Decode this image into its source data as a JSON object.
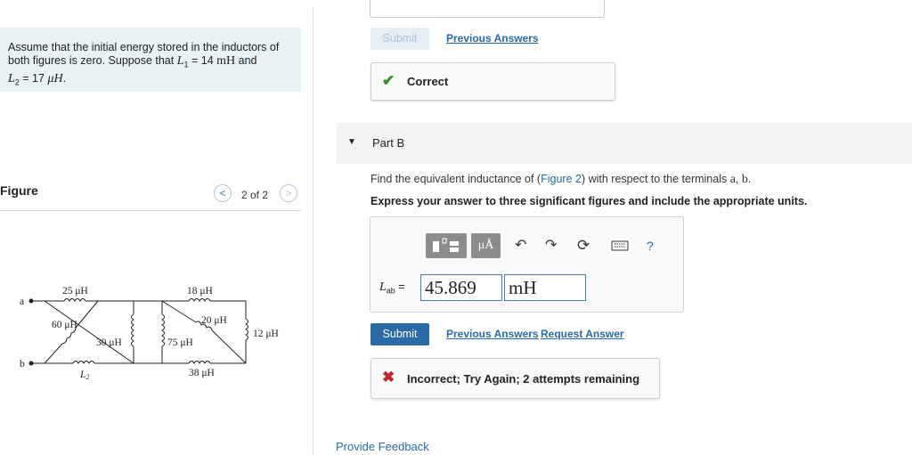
{
  "problem": {
    "text_part1": "Assume that the initial energy stored in the inductors of both figures is zero. Suppose that ",
    "l1_symbol": "L",
    "l1_sub": "1",
    "l1_eq": " = 14 ",
    "l1_unit": "mH",
    "and": " and",
    "l2_symbol": "L",
    "l2_sub": "2",
    "l2_eq": " = 17 ",
    "l2_unit": "μH",
    "period": "."
  },
  "figure": {
    "title": "Figure",
    "counter": "2 of 2",
    "prev_glyph": "<",
    "next_glyph": ">",
    "labels": {
      "l25": "25 μH",
      "l18": "18 μH",
      "l20": "20 μH",
      "l60": "60 μH",
      "l30": "30 μH",
      "l75": "75 μH",
      "l12": "12 μH",
      "l38": "38 μH",
      "l2": "L",
      "l2sub": "2",
      "ta": "a",
      "tb": "b"
    }
  },
  "part_a": {
    "submit_label": "Submit",
    "prev_answers_label": "Previous Answers",
    "status_label": "Correct"
  },
  "part_b": {
    "title": "Part B",
    "question_prefix": "Find the equivalent inductance of (",
    "question_link": "Figure 2",
    "question_suffix": ") with respect to the terminals ",
    "terminal_a": "a",
    "comma": ", ",
    "terminal_b": "b",
    "question_end": ".",
    "instruction": "Express your answer to three significant figures and include the appropriate units.",
    "toolbar": {
      "units_label": "μÅ",
      "help_label": "?"
    },
    "answer_label_symbol": "L",
    "answer_label_sub": "ab",
    "answer_label_eq": " =",
    "value": "45.869",
    "unit": "mH",
    "submit_label": "Submit",
    "prev_answers_label": "Previous Answers",
    "request_answer_label": "Request Answer",
    "status_label": "Incorrect; Try Again; 2 attempts remaining"
  },
  "footer": {
    "feedback_label": "Provide Feedback"
  },
  "colors": {
    "accent": "#2a6aa6",
    "correct": "#3c8a2e",
    "incorrect": "#c0262d",
    "problem_bg": "#e7f3f3"
  }
}
